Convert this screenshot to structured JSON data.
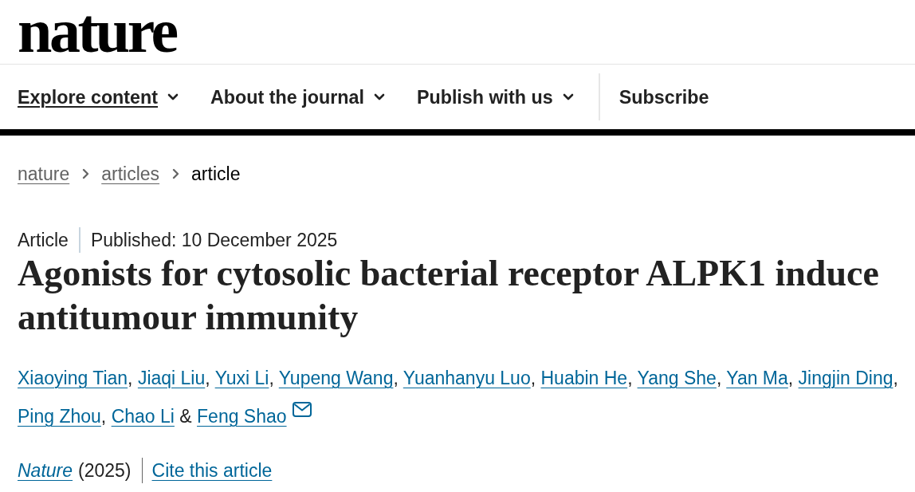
{
  "logo": {
    "text": "nature"
  },
  "nav": {
    "items": [
      {
        "label": "Explore content",
        "kind": "menu",
        "selected": true
      },
      {
        "label": "About the journal",
        "kind": "menu",
        "selected": false
      },
      {
        "label": "Publish with us",
        "kind": "menu",
        "selected": false
      },
      {
        "label": "Subscribe",
        "kind": "link",
        "selected": false
      }
    ]
  },
  "breadcrumb": [
    {
      "label": "nature",
      "current": false
    },
    {
      "label": "articles",
      "current": false
    },
    {
      "label": "article",
      "current": true
    }
  ],
  "article": {
    "type": "Article",
    "published": "Published: 10 December 2025",
    "title": "Agonists for cytosolic bacterial receptor ALPK1 induce antitumour immunity",
    "authors": [
      {
        "name": "Xiaoying Tian",
        "contact": false,
        "separator": {
          "text": ",",
          "kind": "comma"
        }
      },
      {
        "name": "Jiaqi Liu",
        "contact": false,
        "separator": {
          "text": ",",
          "kind": "comma"
        }
      },
      {
        "name": "Yuxi Li",
        "contact": false,
        "separator": {
          "text": ",",
          "kind": "comma"
        }
      },
      {
        "name": "Yupeng Wang",
        "contact": false,
        "separator": {
          "text": ",",
          "kind": "comma"
        }
      },
      {
        "name": "Yuanhanyu Luo",
        "contact": false,
        "separator": {
          "text": ",",
          "kind": "comma"
        }
      },
      {
        "name": "Huabin He",
        "contact": false,
        "separator": {
          "text": ",",
          "kind": "comma"
        }
      },
      {
        "name": "Yang She",
        "contact": false,
        "separator": {
          "text": ",",
          "kind": "comma"
        }
      },
      {
        "name": "Yan Ma",
        "contact": false,
        "separator": {
          "text": ",",
          "kind": "comma"
        }
      },
      {
        "name": "Jingjin Ding",
        "contact": false,
        "separator": {
          "text": ",",
          "kind": "comma"
        }
      },
      {
        "name": "Ping Zhou",
        "contact": false,
        "separator": {
          "text": ",",
          "kind": "comma"
        }
      },
      {
        "name": "Chao Li",
        "contact": false,
        "separator": {
          "text": "&",
          "kind": "conjunction"
        }
      },
      {
        "name": "Feng Shao",
        "contact": true
      }
    ],
    "citation": {
      "journal": "Nature",
      "year": "(2025)",
      "cite_link": "Cite this article"
    }
  }
}
